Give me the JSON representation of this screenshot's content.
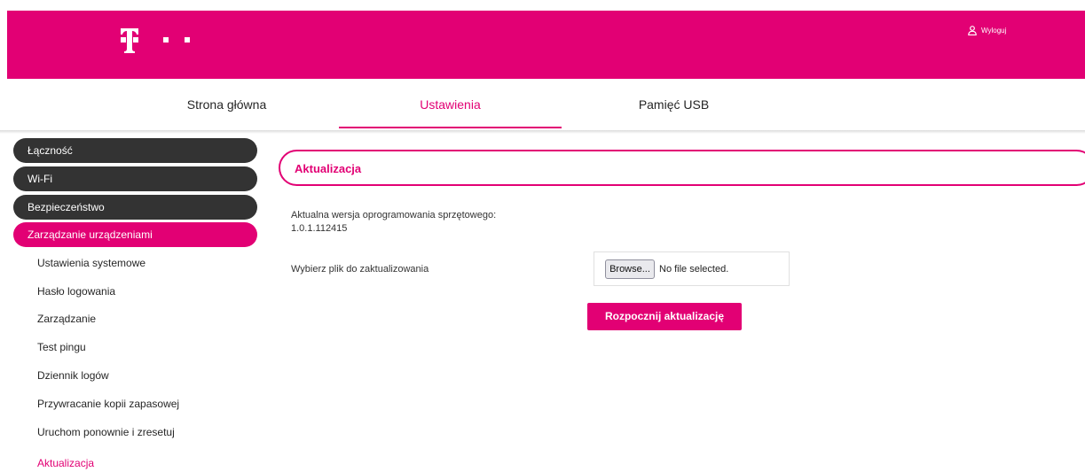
{
  "header": {
    "logo_icon": "telekom-t-logo-icon",
    "logout_icon": "user-icon",
    "logout_label": "Wyloguj",
    "brand_color": "#e20074"
  },
  "topnav": {
    "tabs": [
      {
        "label": "Strona główna",
        "active": false
      },
      {
        "label": "Ustawienia",
        "active": true
      },
      {
        "label": "Pamięć USB",
        "active": false
      }
    ]
  },
  "sidebar": {
    "groups": [
      {
        "label": "Łączność",
        "active": false
      },
      {
        "label": "Wi-Fi",
        "active": false
      },
      {
        "label": "Bezpieczeństwo",
        "active": false
      },
      {
        "label": "Zarządzanie urządzeniami",
        "active": true
      }
    ],
    "subitems": [
      {
        "label": "Ustawienia systemowe",
        "active": false
      },
      {
        "label": "Hasło logowania",
        "active": false
      },
      {
        "label": "Zarządzanie",
        "active": false
      },
      {
        "label": "Test pingu",
        "active": false
      },
      {
        "label": "Dziennik logów",
        "active": false
      },
      {
        "label": "Przywracanie kopii zapasowej",
        "active": false
      },
      {
        "label": "Uruchom ponownie i zresetuj",
        "active": false
      },
      {
        "label": "Aktualizacja",
        "active": true
      }
    ]
  },
  "main": {
    "section_title": "Aktualizacja",
    "firmware_label": "Aktualna wersja oprogramowania sprzętowego:",
    "firmware_version": "1.0.1.112415",
    "file_label": "Wybierz plik do zaktualizowania",
    "browse_label": "Browse...",
    "no_file_text": "No file selected.",
    "start_button": "Rozpocznij aktualizację"
  }
}
